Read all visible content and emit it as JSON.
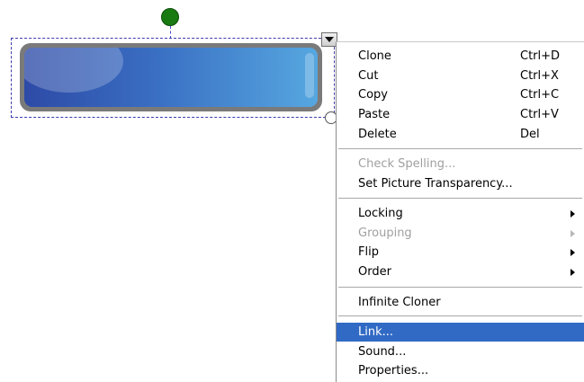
{
  "menu": {
    "group1": [
      {
        "label": "Clone",
        "shortcut": "Ctrl+D"
      },
      {
        "label": "Cut",
        "shortcut": "Ctrl+X"
      },
      {
        "label": "Copy",
        "shortcut": "Ctrl+C"
      },
      {
        "label": "Paste",
        "shortcut": "Ctrl+V"
      },
      {
        "label": "Delete",
        "shortcut": "Del"
      }
    ],
    "group2": [
      {
        "label": "Check Spelling...",
        "disabled": true
      },
      {
        "label": "Set Picture Transparency..."
      }
    ],
    "group3": [
      {
        "label": "Locking",
        "submenu": true
      },
      {
        "label": "Grouping",
        "submenu": true,
        "disabled": true
      },
      {
        "label": "Flip",
        "submenu": true
      },
      {
        "label": "Order",
        "submenu": true
      }
    ],
    "group4": [
      {
        "label": "Infinite Cloner"
      }
    ],
    "group5": [
      {
        "label": "Link...",
        "selected": true
      },
      {
        "label": "Sound..."
      },
      {
        "label": "Properties..."
      }
    ]
  },
  "colors": {
    "selection_highlight": "#316ac5",
    "button_gradient_start": "#2d4aa6",
    "button_gradient_end": "#56a7e0",
    "rotate_handle": "#1a7a12"
  },
  "icons": {
    "rotate_handle": "green-circle",
    "menu_trigger": "triangle-down",
    "submenu": "triangle-right"
  }
}
